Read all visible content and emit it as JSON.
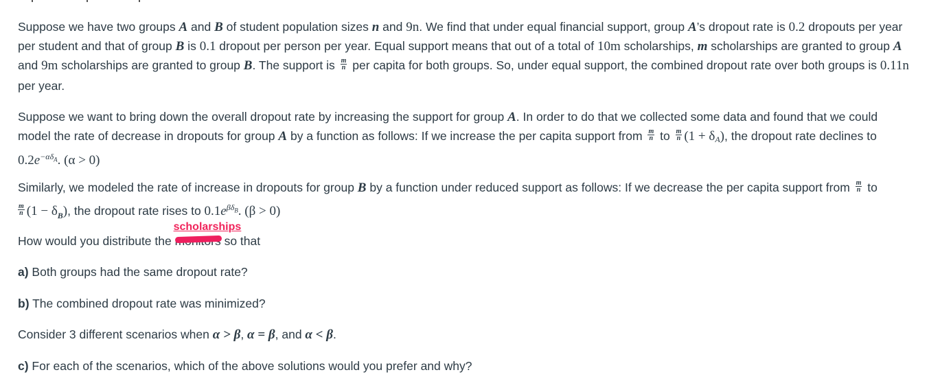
{
  "paragraph1": {
    "line1": {
      "t1": "Suppose we have two groups ",
      "A": "A",
      "t2": " and ",
      "B": "B",
      "t3": " of student population sizes ",
      "n": "n",
      "t4": " and ",
      "nine_n": "9n",
      "t5": ". We find that under equal financial support, group ",
      "A2": "A",
      "t6": "’s dropout rate is ",
      "rateA": "0.2",
      "t7": " dropouts per year"
    },
    "line2": {
      "t1": "per student and that of group ",
      "B": "B",
      "t2": " is ",
      "rateB": "0.1",
      "t3": " dropout per person per year. Equal support means that out of a total of ",
      "ten_m": "10m",
      "t4": " scholarships, ",
      "m": "m",
      "t5": " scholarships are granted to group ",
      "A": "A"
    },
    "line3": {
      "t1": "and ",
      "nine_m": "9m",
      "t2": " scholarships are granted to group ",
      "B": "B",
      "t3": ". The support is ",
      "frac_num": "m",
      "frac_den": "n",
      "t4": " per capita for both groups. So, under equal support, the combined dropout rate over both groups is ",
      "combined": "0.11n"
    },
    "line4": "per year."
  },
  "paragraph2": {
    "line1": {
      "t1": "Suppose we want to bring down the overall dropout rate by increasing the support for group ",
      "A": "A",
      "t2": ". In order to do that we collected some data and found that we could"
    },
    "line2": {
      "t1": "model the rate of decrease in dropouts for group ",
      "A": "A",
      "t2": " by a function as follows: If we increase the per capita support from ",
      "frac_num": "m",
      "frac_den": "n",
      "t3": " to ",
      "frac2_num": "m",
      "frac2_den": "n",
      "expr": "(1 + δ",
      "sub": "A",
      "expr_end": ")",
      "t4": ", the dropout rate declines to"
    },
    "line3": {
      "base": "0.2",
      "e": "e",
      "exp": "−αδ",
      "exp_sub": "A",
      "cond": ". (α > 0)"
    }
  },
  "paragraph3": {
    "line1": {
      "t1": "Similarly, we modeled the rate of increase in dropouts for group ",
      "B": "B",
      "t2": " by a function under reduced support as follows: If we decrease the per capita support from ",
      "frac_num": "m",
      "frac_den": "n",
      "t3": " to"
    },
    "line2": {
      "frac_num": "m",
      "frac_den": "n",
      "expr": "(1 − δ",
      "sub": "B",
      "expr_end": ")",
      "t1": ", the dropout rate rises to ",
      "base": "0.1",
      "e": "e",
      "exp": "βδ",
      "exp_sub": "B",
      "cond": ". (β > 0)"
    }
  },
  "question": {
    "t1": "How would you distribute the ",
    "struck_word": "monitors",
    "annotation": "scholarships",
    "t2": " so that"
  },
  "part_a": {
    "label": "a)",
    "text": " Both groups had the same dropout rate?"
  },
  "part_b": {
    "label": "b)",
    "text": " The combined dropout rate was minimized?"
  },
  "scenarios": {
    "t1": "Consider 3 different scenarios when ",
    "s1": "α > β",
    "sep1": ", ",
    "s2": "α = β",
    "sep2": ", and ",
    "s3": "α < β",
    "end": "."
  },
  "part_c": {
    "label": "c)",
    "text": " For each of the scenarios, which of the above solutions would you prefer and why?"
  },
  "colors": {
    "text": "#2d3b45",
    "annotation": "#f0245b"
  }
}
